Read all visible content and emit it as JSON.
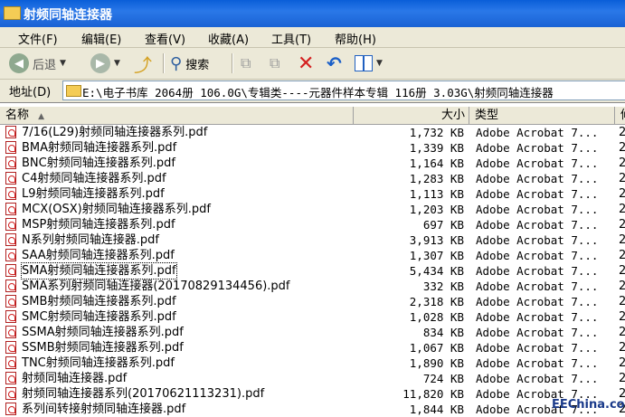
{
  "window": {
    "title": "射频同轴连接器"
  },
  "menu": [
    "文件(F)",
    "编辑(E)",
    "查看(V)",
    "收藏(A)",
    "工具(T)",
    "帮助(H)"
  ],
  "toolbar": {
    "back_label": "后退",
    "search_label": "搜索"
  },
  "address": {
    "label": "地址(D)",
    "path": "E:\\电子书库 2064册 106.0G\\专辑类----元器件样本专辑 116册 3.03G\\射频同轴连接器"
  },
  "columns": {
    "name": "名称",
    "size": "大小",
    "type": "类型",
    "extra": "修"
  },
  "files": [
    {
      "name": "7/16(L29)射频同轴连接器系列.pdf",
      "size": "1,732 KB",
      "type": "Adobe Acrobat 7...",
      "extra": "2"
    },
    {
      "name": "BMA射频同轴连接器系列.pdf",
      "size": "1,339 KB",
      "type": "Adobe Acrobat 7...",
      "extra": "2"
    },
    {
      "name": "BNC射频同轴连接器系列.pdf",
      "size": "1,164 KB",
      "type": "Adobe Acrobat 7...",
      "extra": "2"
    },
    {
      "name": "C4射频同轴连接器系列.pdf",
      "size": "1,283 KB",
      "type": "Adobe Acrobat 7...",
      "extra": "2"
    },
    {
      "name": "L9射频同轴连接器系列.pdf",
      "size": "1,113 KB",
      "type": "Adobe Acrobat 7...",
      "extra": "2"
    },
    {
      "name": "MCX(OSX)射频同轴连接器系列.pdf",
      "size": "1,203 KB",
      "type": "Adobe Acrobat 7...",
      "extra": "2"
    },
    {
      "name": "MSP射频同轴连接器系列.pdf",
      "size": "697 KB",
      "type": "Adobe Acrobat 7...",
      "extra": "2"
    },
    {
      "name": "N系列射频同轴连接器.pdf",
      "size": "3,913 KB",
      "type": "Adobe Acrobat 7...",
      "extra": "2"
    },
    {
      "name": "SAA射频同轴连接器系列.pdf",
      "size": "1,307 KB",
      "type": "Adobe Acrobat 7...",
      "extra": "2"
    },
    {
      "name": "SMA射频同轴连接器系列.pdf",
      "size": "5,434 KB",
      "type": "Adobe Acrobat 7...",
      "extra": "2",
      "selected": true
    },
    {
      "name": "SMA系列射频同轴连接器(20170829134456).pdf",
      "size": "332 KB",
      "type": "Adobe Acrobat 7...",
      "extra": "2"
    },
    {
      "name": "SMB射频同轴连接器系列.pdf",
      "size": "2,318 KB",
      "type": "Adobe Acrobat 7...",
      "extra": "2"
    },
    {
      "name": "SMC射频同轴连接器系列.pdf",
      "size": "1,028 KB",
      "type": "Adobe Acrobat 7...",
      "extra": "2"
    },
    {
      "name": "SSMA射频同轴连接器系列.pdf",
      "size": "834 KB",
      "type": "Adobe Acrobat 7...",
      "extra": "2"
    },
    {
      "name": "SSMB射频同轴连接器系列.pdf",
      "size": "1,067 KB",
      "type": "Adobe Acrobat 7...",
      "extra": "2"
    },
    {
      "name": "TNC射频同轴连接器系列.pdf",
      "size": "1,890 KB",
      "type": "Adobe Acrobat 7...",
      "extra": "2"
    },
    {
      "name": "射频同轴连接器.pdf",
      "size": "724 KB",
      "type": "Adobe Acrobat 7...",
      "extra": "2"
    },
    {
      "name": "射频同轴连接器系列(20170621113231).pdf",
      "size": "11,820 KB",
      "type": "Adobe Acrobat 7...",
      "extra": "2"
    },
    {
      "name": "系列间转接射频同轴连接器.pdf",
      "size": "1,844 KB",
      "type": "Adobe Acrobat 7...",
      "extra": "2"
    }
  ],
  "watermark": "EEChina.com",
  "colors": {
    "titlebar": "#0a5ed8",
    "chrome": "#ece9d8",
    "back": "#3a8a3a"
  }
}
